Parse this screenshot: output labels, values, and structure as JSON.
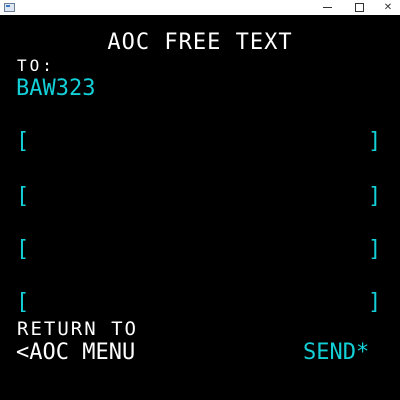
{
  "window": {
    "controls": {
      "minimize": "minimize",
      "maximize": "maximize",
      "close": "✕"
    }
  },
  "mcdu": {
    "title": "AOC FREE TEXT",
    "to_label": "TO:",
    "to_value": "BAW323",
    "bracket_open": "[",
    "bracket_close": "]",
    "free_text_lines": [
      "",
      "",
      "",
      ""
    ],
    "return_label": "RETURN TO",
    "aoc_menu": "<AOC MENU",
    "send": "SEND*"
  },
  "colors": {
    "background": "#000000",
    "white_text": "#ffffff",
    "cyan_text": "#13d0d8"
  }
}
